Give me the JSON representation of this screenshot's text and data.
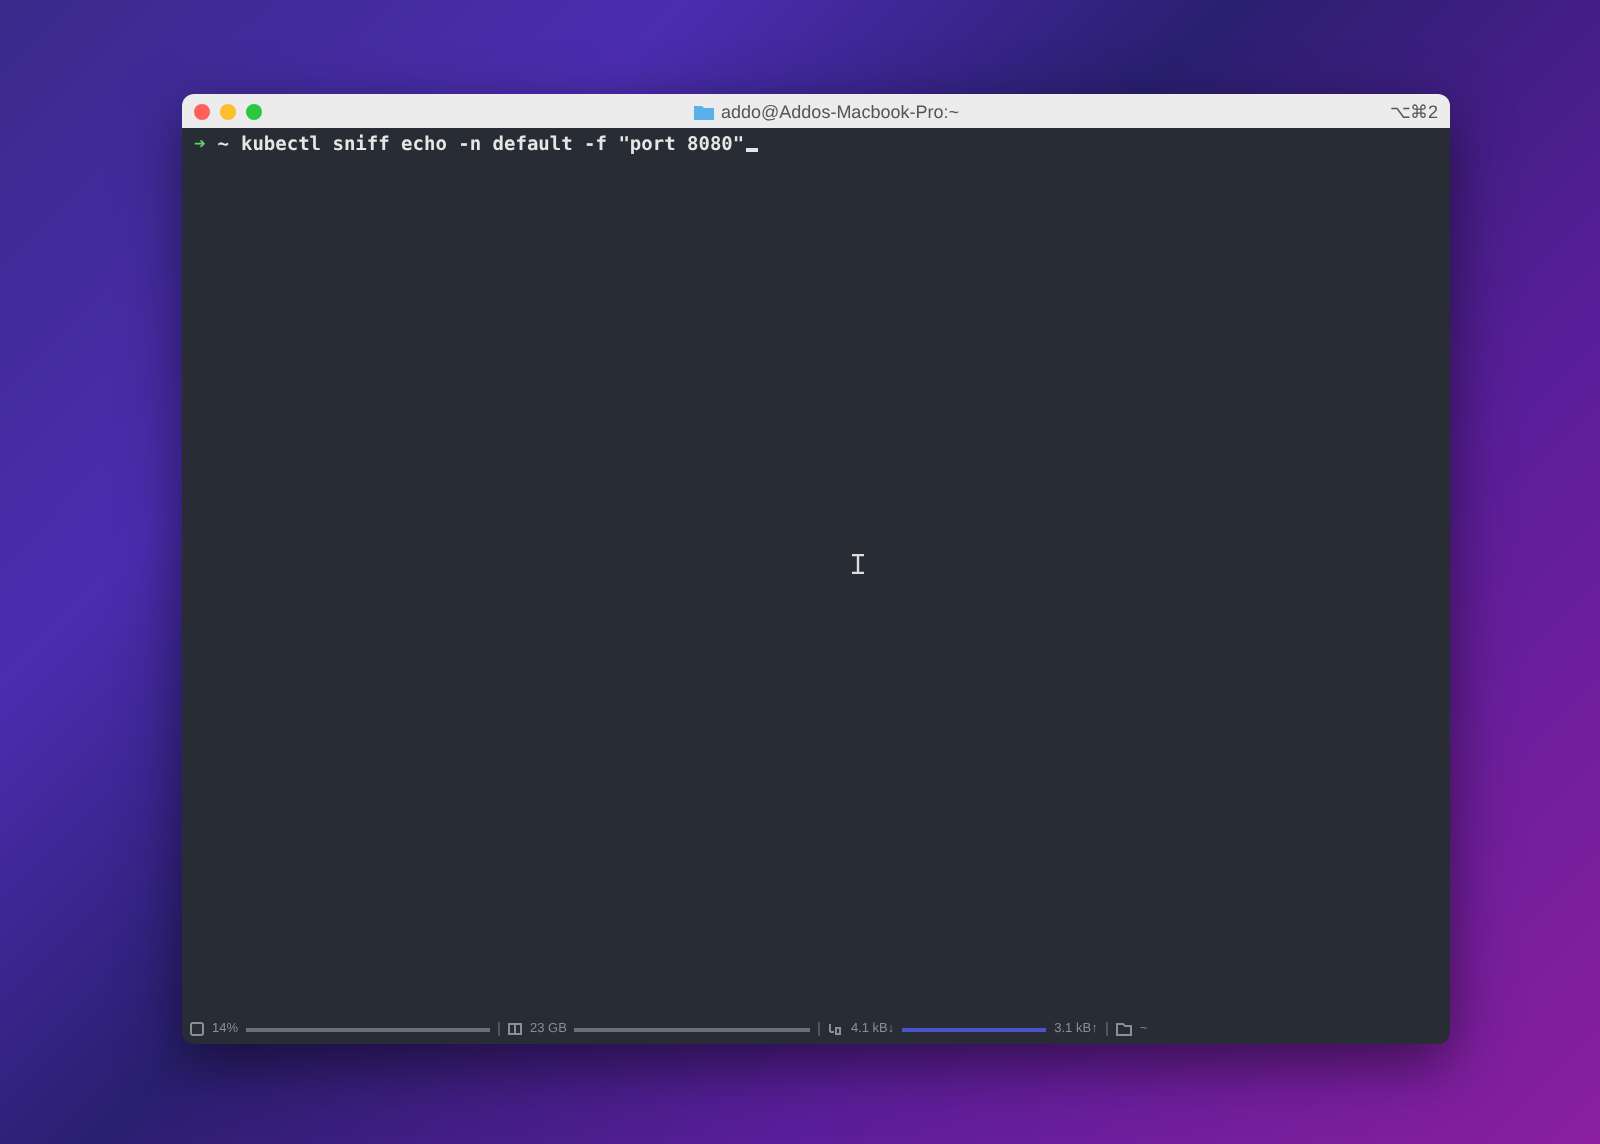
{
  "window": {
    "title": "addo@Addos-Macbook-Pro:~",
    "shortcut": "⌥⌘2"
  },
  "terminal": {
    "prompt_arrow": "➜",
    "cwd": "~",
    "command": "kubectl sniff echo -n default -f \"port 8080\""
  },
  "status_bar": {
    "cpu": "14%",
    "memory": "23 GB",
    "download": "4.1 kB↓",
    "upload": "3.1 kB↑",
    "folder": "~"
  }
}
